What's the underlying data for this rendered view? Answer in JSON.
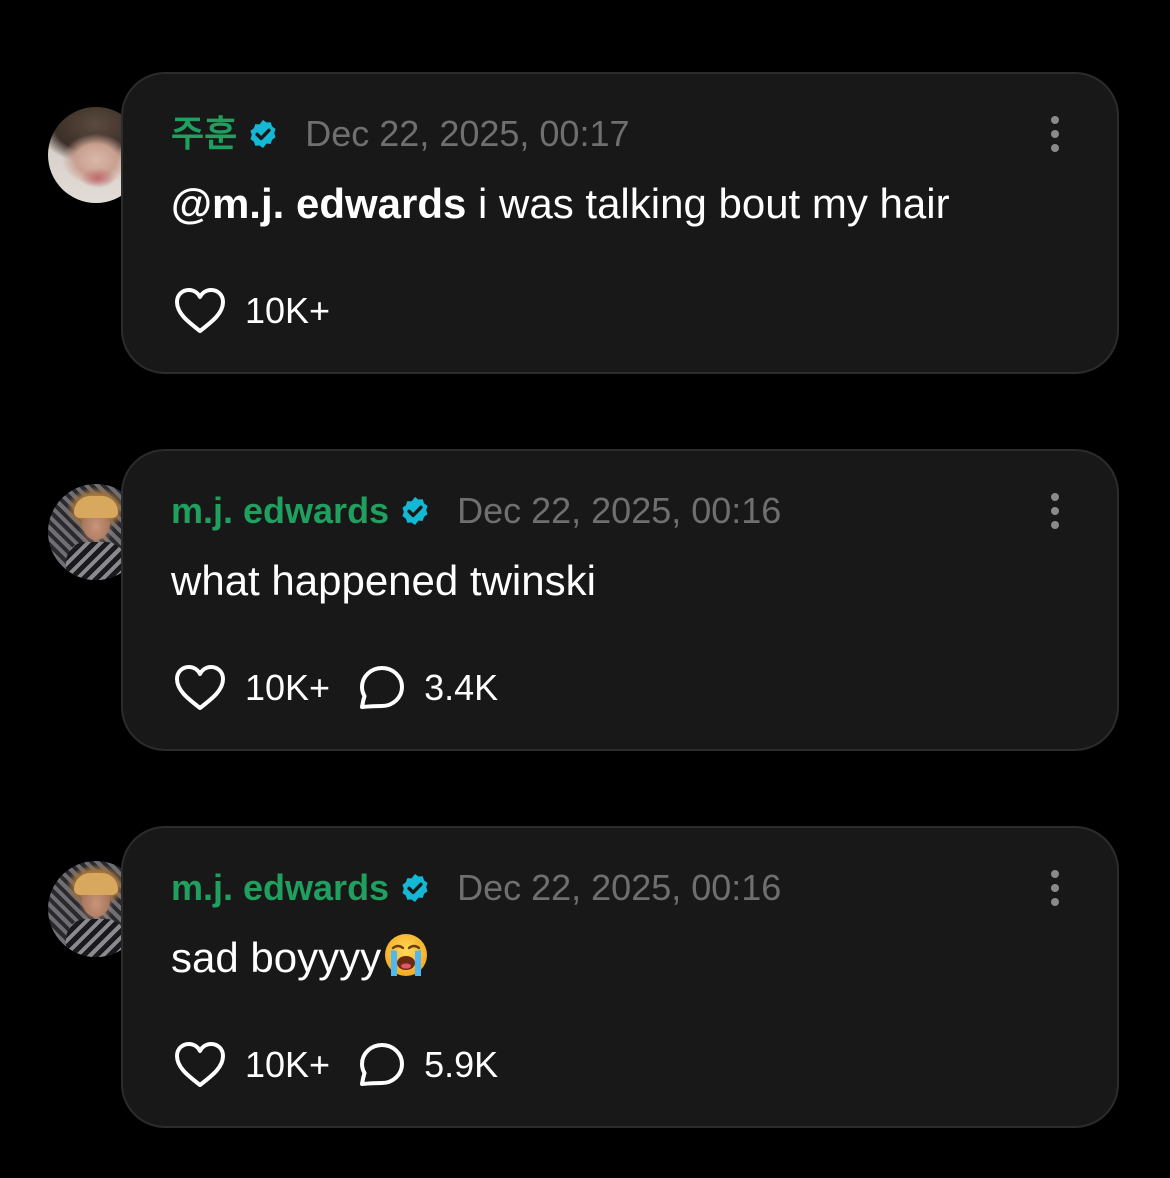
{
  "colors": {
    "background": "#000000",
    "card": "#181818",
    "card_border": "#2c2c2c",
    "author": "#1fa05e",
    "verified_badge": "#14b8d4",
    "timestamp": "#6f6f6f",
    "text": "#ffffff"
  },
  "comments": [
    {
      "author": "주훈",
      "verified": true,
      "timestamp": "Dec 22, 2025, 00:17",
      "mention": "@m.j. edwards",
      "text": " i was talking bout my hair",
      "likes": "10K+",
      "icons": {
        "like": "heart-icon",
        "more": "more-vertical-icon",
        "badge": "verified-badge-icon"
      }
    },
    {
      "author": "m.j. edwards",
      "verified": true,
      "timestamp": "Dec 22, 2025, 00:16",
      "text": "what happened twinski",
      "likes": "10K+",
      "replies": "3.4K",
      "icons": {
        "like": "heart-icon",
        "reply": "comment-bubble-icon",
        "more": "more-vertical-icon"
      }
    },
    {
      "author": "m.j. edwards",
      "verified": true,
      "timestamp": "Dec 22, 2025, 00:16",
      "text": "sad boyyyy",
      "emoji": "loudly-crying-face-emoji",
      "likes": "10K+",
      "replies": "5.9K",
      "icons": {
        "like": "heart-icon",
        "reply": "comment-bubble-icon",
        "more": "more-vertical-icon"
      }
    }
  ]
}
